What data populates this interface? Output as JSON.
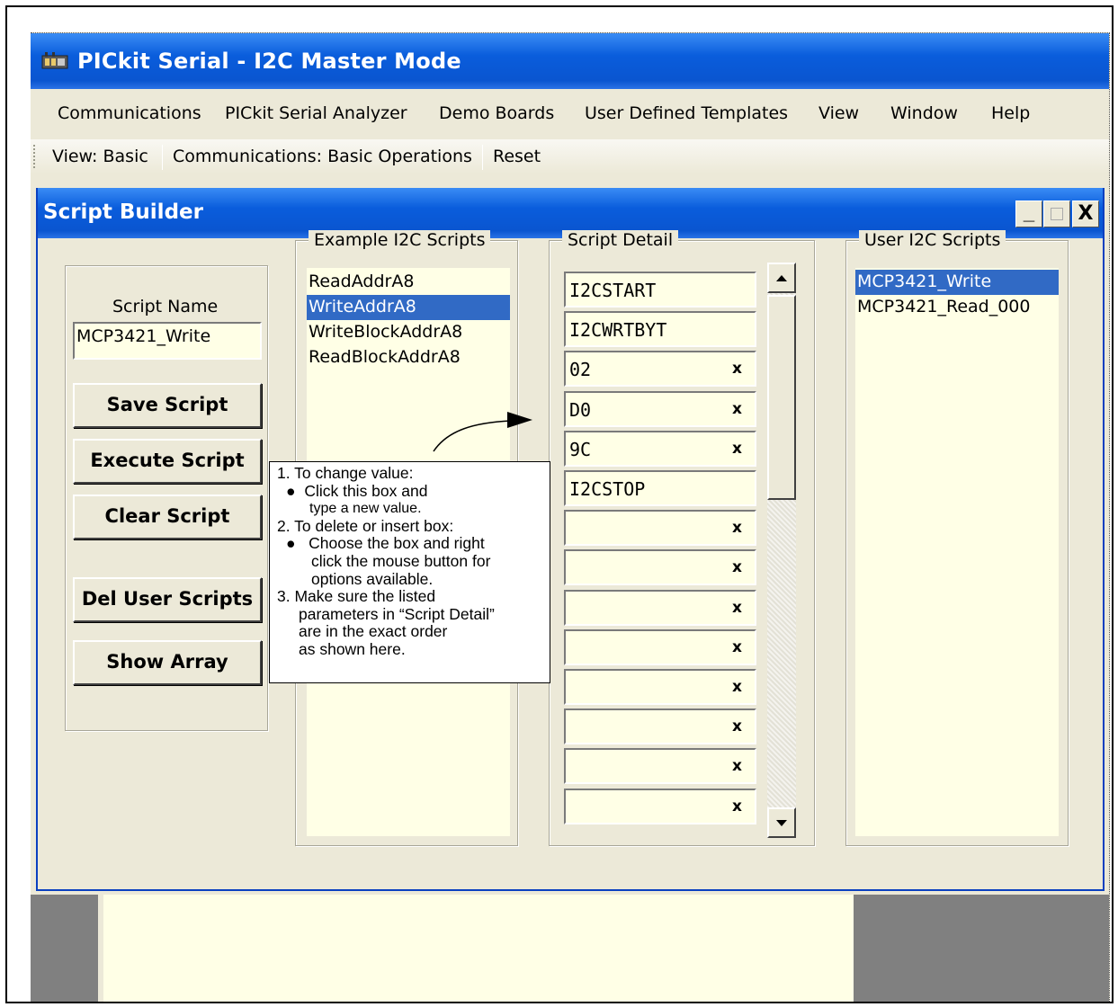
{
  "app": {
    "title": "PICkit Serial - I2C Master Mode",
    "icon": "pickit-app-icon"
  },
  "menu": [
    "Communications",
    "PICkit Serial Analyzer",
    "Demo Boards",
    "User Defined Templates",
    "View",
    "Window",
    "Help"
  ],
  "toolbar": [
    "View: Basic",
    "Communications: Basic Operations",
    "Reset"
  ],
  "script_builder": {
    "title": "Script Builder",
    "window_buttons": {
      "minimize": "_",
      "close": "X"
    },
    "script_name_label": "Script Name",
    "script_name_value": "MCP3421_Write",
    "buttons": [
      "Save Script",
      "Execute Script",
      "Clear Script",
      "Del User Scripts",
      "Show Array"
    ],
    "example_group_label": "Example I2C Scripts",
    "example_scripts": [
      "ReadAddrA8",
      "WriteAddrA8",
      "WriteBlockAddrA8",
      "ReadBlockAddrA8"
    ],
    "example_selected_index": 1,
    "detail_group_label": "Script Detail",
    "detail_entries": [
      {
        "value": "I2CSTART",
        "x": ""
      },
      {
        "value": "I2CWRTBYT",
        "x": ""
      },
      {
        "value": "02",
        "x": "x"
      },
      {
        "value": "D0",
        "x": "x"
      },
      {
        "value": "9C",
        "x": "x"
      },
      {
        "value": "I2CSTOP",
        "x": ""
      },
      {
        "value": "",
        "x": "x"
      },
      {
        "value": "",
        "x": "x"
      },
      {
        "value": "",
        "x": "x"
      },
      {
        "value": "",
        "x": "x"
      },
      {
        "value": "",
        "x": "x"
      },
      {
        "value": "",
        "x": "x"
      },
      {
        "value": "",
        "x": "x"
      },
      {
        "value": "",
        "x": "x"
      }
    ],
    "user_group_label": "User I2C Scripts",
    "user_scripts": [
      "MCP3421_Write",
      "MCP3421_Read_000"
    ],
    "user_selected_index": 0
  },
  "callout": {
    "lines": [
      "1. To change value:",
      "Click this box and",
      "type a new value.",
      "2. To delete or insert box:",
      "Choose the box and right",
      "click the mouse button for",
      "options available.",
      "3. Make sure the listed",
      "parameters in “Script Detail”",
      "are in the exact order",
      "as shown here."
    ],
    "bullet": "●"
  },
  "colors": {
    "titlebar": "#0a5ddc",
    "selection": "#316ac5",
    "list_bg": "#ffffe6",
    "face": "#ece9d8"
  }
}
